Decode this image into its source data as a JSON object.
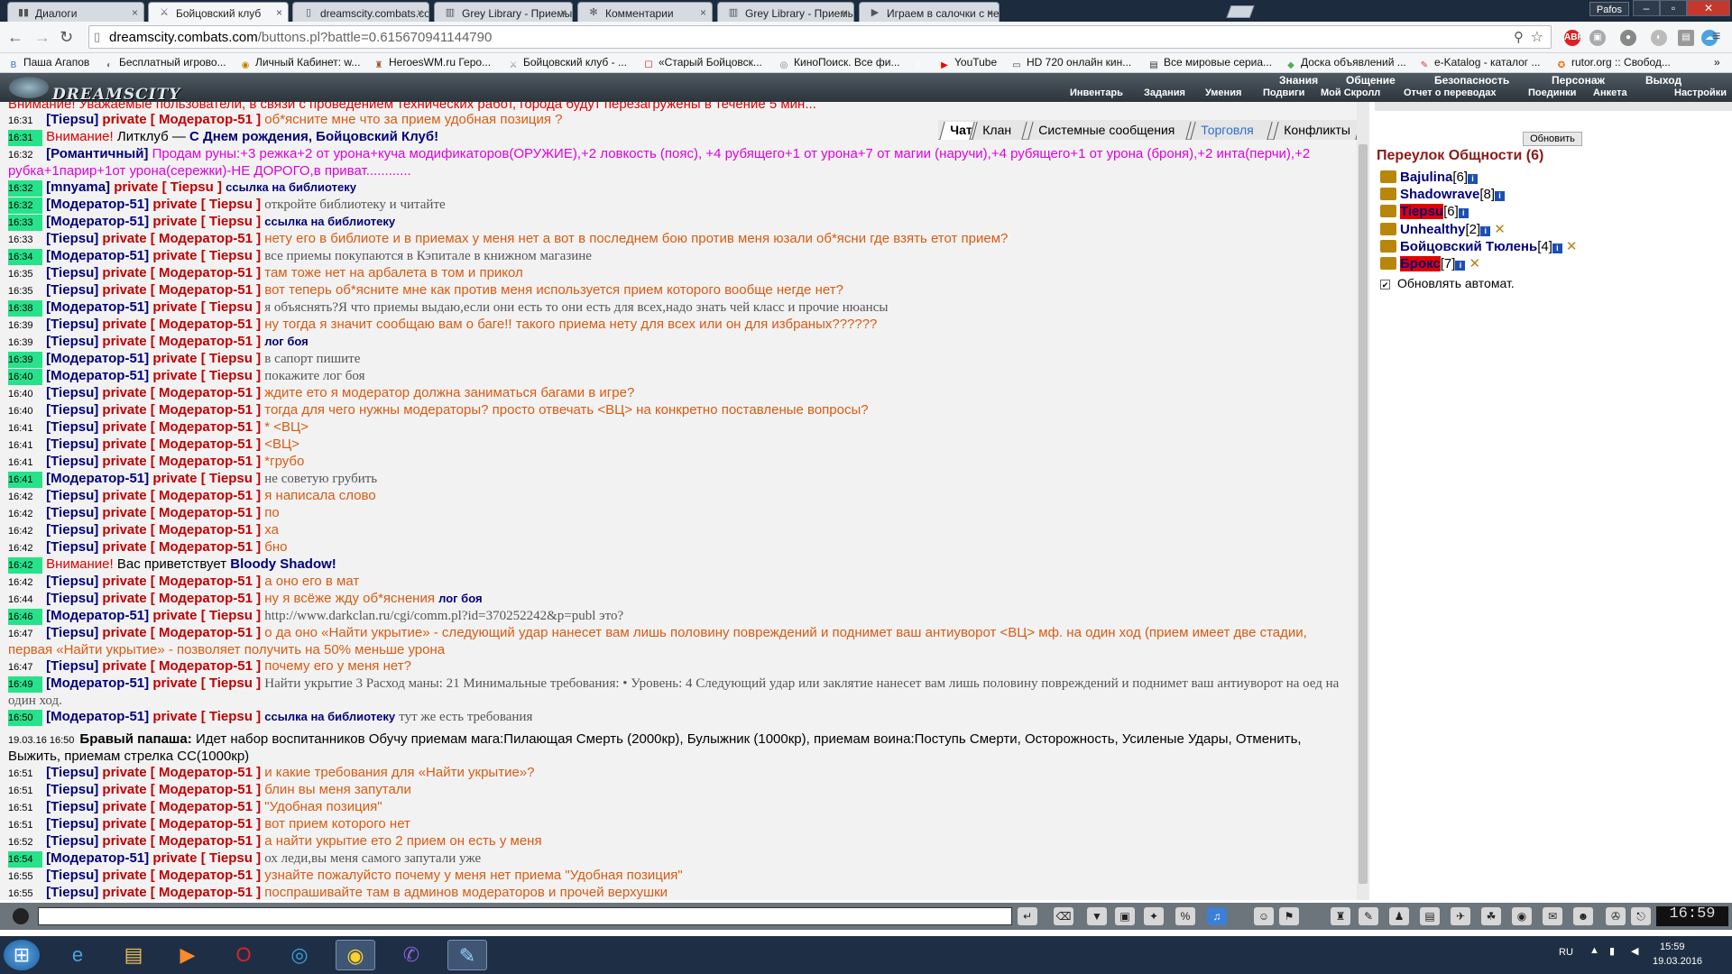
{
  "browser": {
    "tabs": [
      {
        "title": "Диалоги",
        "icon": "vk-icon",
        "active": false
      },
      {
        "title": "Бойцовский клуб",
        "icon": "bk-icon",
        "active": true
      },
      {
        "title": "dreamscity.combats.com/...",
        "icon": "page-icon",
        "active": false
      },
      {
        "title": "Grey Library - Приемы Ст...",
        "icon": "library-icon",
        "active": false
      },
      {
        "title": "Комментарии",
        "icon": "gear-icon",
        "active": false
      },
      {
        "title": "Grey Library - Приемы Ст...",
        "icon": "library-icon",
        "active": false
      },
      {
        "title": "Играем в салочки с незн...",
        "icon": "youtube-icon",
        "active": false
      }
    ],
    "window_user": "Pafos",
    "url_host": "dreamscity.combats.com",
    "url_path": "/buttons.pl?battle=0.615670941144790",
    "bookmarks": [
      "Паша Агапов",
      "Бесплатный игрово...",
      "Личный Кабинет: w...",
      "HeroesWM.ru Геро...",
      "Бойцовский клуб - ...",
      "«Старый Бойцовск...",
      "КиноПоиск. Все фи...",
      "",
      "YouTube",
      "HD 720 онлайн кин...",
      "Все мировые сериа...",
      "Доска объявлений ...",
      "e-Katalog - каталог ...",
      "rutor.org :: Свобод..."
    ]
  },
  "game": {
    "logo": "DREAMSCITY",
    "menu_top": [
      "Знания",
      "Общение",
      "Безопасность",
      "Персонаж",
      "Выход"
    ],
    "menu_bottom": [
      "Инвентарь",
      "Задания",
      "Умения",
      "Подвиги",
      "Мой Скролл",
      "Отчет о переводах",
      "Поединки",
      "Анкета",
      "Настройки"
    ],
    "chat_tabs": [
      "Чат",
      "Клан",
      "Системные сообщения",
      "Торговля",
      "Конфликты"
    ],
    "chat": {
      "top_line": "Внимание! Уважаемые пользователи, в связи с проведением технических работ, города будут перезагружены в течение 5 мин...",
      "lines": [
        {
          "t": "16:31",
          "hl": false,
          "from": "[Tiepsu]",
          "to": "[ Модератор-51 ]",
          "msg": "об*ясните мне что за прием удобная позиция ?",
          "c": "o"
        },
        {
          "t": "16:31",
          "hl": true,
          "kind": "warn",
          "warn": "Внимание!",
          "text": "Литклуб —",
          "bold": "С Днем рождения, Бойцовский Клуб!"
        },
        {
          "t": "16:32",
          "hl": false,
          "kind": "trade",
          "from": "[Романтичный]",
          "msg": "Продам руны:+3 режка+2 от урона+куча модификаторов(ОРУЖИЕ),+2 ловкость (пояс), +4 рубящего+1 от урона+7 от магии (наручи),+4 рубящего+1 от урона (броня),+2 инта(перчи),+2 рубка+1парир+1от урона(сережки)-НЕ ДОРОГО,в приват............"
        },
        {
          "t": "16:32",
          "hl": true,
          "from": "[mnyama]",
          "to": "[ Tiepsu ]",
          "msg": "ссылка на библиотеку",
          "c": "b"
        },
        {
          "t": "16:32",
          "hl": true,
          "from": "[Модератор-51]",
          "to": "[ Tiepsu ]",
          "msg": "откройте библиотеку и читайте",
          "c": "g"
        },
        {
          "t": "16:33",
          "hl": true,
          "from": "[Модератор-51]",
          "to": "[ Tiepsu ]",
          "msg": "ссылка на библиотеку",
          "c": "b"
        },
        {
          "t": "16:33",
          "hl": false,
          "from": "[Tiepsu]",
          "to": "[ Модератор-51 ]",
          "msg": "нету его в библиоте и в приемах у меня нет а вот в последнем бою против меня юзали об*ясни где взять етот прием?",
          "c": "o"
        },
        {
          "t": "16:34",
          "hl": true,
          "from": "[Модератор-51]",
          "to": "[ Tiepsu ]",
          "msg": "все приемы покупаются в Кэпитале в книжном магазине",
          "c": "g"
        },
        {
          "t": "16:35",
          "hl": false,
          "from": "[Tiepsu]",
          "to": "[ Модератор-51 ]",
          "msg": "там тоже нет на арбалета в том и прикол",
          "c": "o"
        },
        {
          "t": "16:35",
          "hl": false,
          "from": "[Tiepsu]",
          "to": "[ Модератор-51 ]",
          "msg": "вот теперь об*ясните мне как против меня используется прием которого вообще негде нет?",
          "c": "o"
        },
        {
          "t": "16:38",
          "hl": true,
          "from": "[Модератор-51]",
          "to": "[ Tiepsu ]",
          "msg": "я объяснять?Я что приемы выдаю,если они есть то они есть для всех,надо знать чей класс и прочие нюансы",
          "c": "g"
        },
        {
          "t": "16:39",
          "hl": false,
          "from": "[Tiepsu]",
          "to": "[ Модератор-51 ]",
          "msg": "ну тогда я значит сообщаю вам о баге!! такого приема нету для всех или он для избраных??????",
          "c": "o"
        },
        {
          "t": "16:39",
          "hl": false,
          "from": "[Tiepsu]",
          "to": "[ Модератор-51 ]",
          "msg": "лог боя",
          "c": "b"
        },
        {
          "t": "16:39",
          "hl": true,
          "from": "[Модератор-51]",
          "to": "[ Tiepsu ]",
          "msg": "в сапорт пишите",
          "c": "g"
        },
        {
          "t": "16:40",
          "hl": true,
          "from": "[Модератор-51]",
          "to": "[ Tiepsu ]",
          "msg": "покажите лог боя",
          "c": "g"
        },
        {
          "t": "16:40",
          "hl": false,
          "from": "[Tiepsu]",
          "to": "[ Модератор-51 ]",
          "msg": "ждите ето я модератор должна заниматься багами в игре?",
          "c": "o"
        },
        {
          "t": "16:40",
          "hl": false,
          "from": "[Tiepsu]",
          "to": "[ Модератор-51 ]",
          "msg": "тогда для чего нужны модераторы? просто отвечать <ВЦ> на конкретно поставленые вопросы?",
          "c": "o"
        },
        {
          "t": "16:41",
          "hl": false,
          "from": "[Tiepsu]",
          "to": "[ Модератор-51 ]",
          "msg": "* <ВЦ>",
          "c": "o"
        },
        {
          "t": "16:41",
          "hl": false,
          "from": "[Tiepsu]",
          "to": "[ Модератор-51 ]",
          "msg": "<ВЦ>",
          "c": "o"
        },
        {
          "t": "16:41",
          "hl": false,
          "from": "[Tiepsu]",
          "to": "[ Модератор-51 ]",
          "msg": "*грубо",
          "c": "o"
        },
        {
          "t": "16:41",
          "hl": true,
          "from": "[Модератор-51]",
          "to": "[ Tiepsu ]",
          "msg": "не советую грубить",
          "c": "g"
        },
        {
          "t": "16:42",
          "hl": false,
          "from": "[Tiepsu]",
          "to": "[ Модератор-51 ]",
          "msg": "я написала слово",
          "c": "o"
        },
        {
          "t": "16:42",
          "hl": false,
          "from": "[Tiepsu]",
          "to": "[ Модератор-51 ]",
          "msg": "по",
          "c": "o"
        },
        {
          "t": "16:42",
          "hl": false,
          "from": "[Tiepsu]",
          "to": "[ Модератор-51 ]",
          "msg": "ха",
          "c": "o"
        },
        {
          "t": "16:42",
          "hl": false,
          "from": "[Tiepsu]",
          "to": "[ Модератор-51 ]",
          "msg": "бно",
          "c": "o"
        },
        {
          "t": "16:42",
          "hl": true,
          "kind": "warn",
          "warn": "Внимание!",
          "text": "Вас приветствует",
          "bold": "Bloody Shadow!"
        },
        {
          "t": "16:42",
          "hl": false,
          "from": "[Tiepsu]",
          "to": "[ Модератор-51 ]",
          "msg": "а оно его в мат",
          "c": "o"
        },
        {
          "t": "16:44",
          "hl": false,
          "from": "[Tiepsu]",
          "to": "[ Модератор-51 ]",
          "msg": "ну я всёже жду об*яснения",
          "c": "o",
          "extra": "лог боя"
        },
        {
          "t": "16:46",
          "hl": true,
          "from": "[Модератор-51]",
          "to": "[ Tiepsu ]",
          "msg": "http://www.darkclan.ru/cgi/comm.pl?id=370252242&p=publ это?",
          "c": "g"
        },
        {
          "t": "16:47",
          "hl": false,
          "wrap": true,
          "from": "[Tiepsu]",
          "to": "[ Модератор-51 ]",
          "msg": "о да оно «Найти укрытие» - следующий удар нанесет вам лишь половину повреждений и поднимет ваш антиуворот <ВЦ> мф. на один ход (прием имеет две стадии, первая «Найти укрытие» - позволяет получить на 50% меньше урона",
          "c": "o"
        },
        {
          "t": "16:47",
          "hl": false,
          "from": "[Tiepsu]",
          "to": "[ Модератор-51 ]",
          "msg": "почему его у меня нет?",
          "c": "o"
        },
        {
          "t": "16:49",
          "hl": true,
          "wrap": true,
          "from": "[Модератор-51]",
          "to": "[ Tiepsu ]",
          "msg": "Найти укрытие 3 Расход маны: 21 Минимальные требования: • Уровень: 4 Следующий удар или заклятие нанесет вам лишь половину повреждений и поднимет ваш антиуворот на оед на один ход.",
          "c": "g"
        },
        {
          "t": "16:50",
          "hl": true,
          "from": "[Модератор-51]",
          "to": "[ Tiepsu ]",
          "msg": "ссылка на библиотеку",
          "c": "b",
          "extra_g": "тут же есть требования"
        },
        {
          "kind": "ann",
          "t": "19.03.16 16:50",
          "who": "Бравый папаша:",
          "text": "Идет набор воспитанников   Обучу приемам мага:Пилающая Смерть (2000кр), Булыжник (1000кр), приемам воина:Поступь Смерти, Осторожность, Усиленые Удары, Отменить, Выжить, приемам стрелка СС(1000кр)"
        },
        {
          "t": "16:51",
          "hl": false,
          "from": "[Tiepsu]",
          "to": "[ Модератор-51 ]",
          "msg": "и какие требования для «Найти укрытие»?",
          "c": "o"
        },
        {
          "t": "16:51",
          "hl": false,
          "from": "[Tiepsu]",
          "to": "[ Модератор-51 ]",
          "msg": "блин вы меня запутали",
          "c": "o"
        },
        {
          "t": "16:51",
          "hl": false,
          "from": "[Tiepsu]",
          "to": "[ Модератор-51 ]",
          "msg": "\"Удобная позиция\"",
          "c": "o"
        },
        {
          "t": "16:51",
          "hl": false,
          "from": "[Tiepsu]",
          "to": "[ Модератор-51 ]",
          "msg": "вот прием которого нет",
          "c": "o"
        },
        {
          "t": "16:52",
          "hl": false,
          "from": "[Tiepsu]",
          "to": "[ Модератор-51 ]",
          "msg": "а найти укрытие ето 2 прием он есть у меня",
          "c": "o"
        },
        {
          "t": "16:54",
          "hl": true,
          "from": "[Модератор-51]",
          "to": "[ Tiepsu ]",
          "msg": "ох леди,вы меня самого запутали уже",
          "c": "g"
        },
        {
          "t": "16:55",
          "hl": false,
          "from": "[Tiepsu]",
          "to": "[ Модератор-51 ]",
          "msg": "узнайте пожалуйсто почему у меня нет приема \"Удобная позиция\"",
          "c": "o"
        },
        {
          "t": "16:55",
          "hl": false,
          "from": "[Tiepsu]",
          "to": "[ Модератор-51 ]",
          "msg": "поспрашивайте там в админов модераторов и прочей верхушки",
          "c": "o"
        }
      ]
    },
    "room": {
      "refresh_label": "Обновить",
      "title": "Переулок Общности (6)",
      "users": [
        {
          "name": "Bajulina",
          "level": "[6]",
          "highlight": false,
          "x": false
        },
        {
          "name": "Shadowrave",
          "level": "[8]",
          "highlight": false,
          "x": false
        },
        {
          "name": "Tiepsu",
          "level": "[6]",
          "highlight": true,
          "x": false
        },
        {
          "name": "Unhealthy",
          "level": "[2]",
          "highlight": false,
          "x": true
        },
        {
          "name": "Бойцовский Тюлень",
          "level": "[4]",
          "highlight": false,
          "x": true
        },
        {
          "name": "Брокс",
          "level": "[7]",
          "highlight": true,
          "x": true
        }
      ],
      "auto_update_label": "Обновлять автомат."
    },
    "clock": "16:59"
  },
  "os": {
    "lang": "RU",
    "time": "15:59",
    "date": "19.03.2016"
  }
}
